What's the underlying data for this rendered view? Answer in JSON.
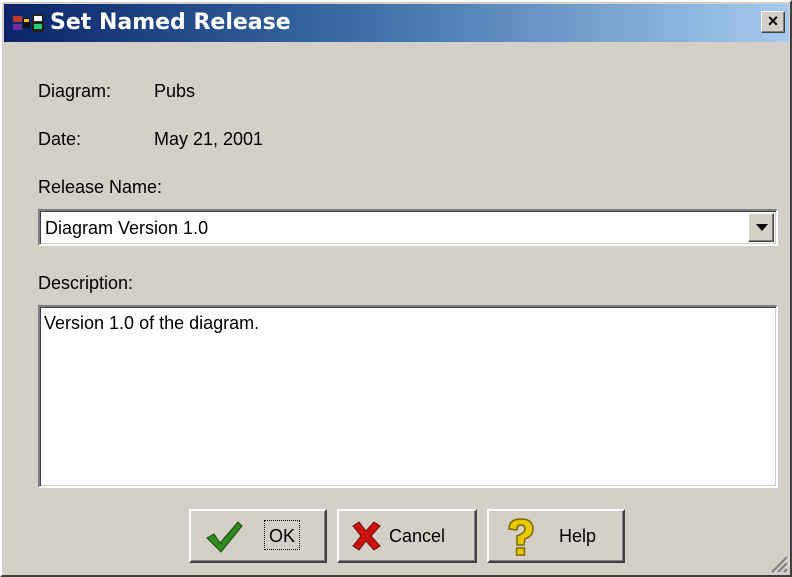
{
  "window": {
    "title": "Set Named Release",
    "close_glyph": "×"
  },
  "info": {
    "diagram_label": "Diagram:",
    "diagram_value": "Pubs",
    "date_label": "Date:",
    "date_value": "May 21, 2001"
  },
  "release": {
    "label": "Release Name:",
    "selected_value": "Diagram Version 1.0"
  },
  "description": {
    "label": "Description:",
    "value": "Version 1.0 of the diagram."
  },
  "buttons": {
    "ok_label": "OK",
    "cancel_label": "Cancel",
    "help_label": "Help"
  },
  "icons": {
    "app": "app-icon",
    "ok": "checkmark-icon",
    "cancel": "red-x-icon",
    "help": "question-mark-icon",
    "dropdown": "chevron-down-icon",
    "resize": "size-grip-icon"
  },
  "colors": {
    "title_bar_start": "#0a246a",
    "title_bar_end": "#a6caf0",
    "face": "#d4d0c8",
    "ok_icon": "#2e8b1f",
    "cancel_icon": "#cc1111",
    "help_icon": "#e8c800"
  }
}
